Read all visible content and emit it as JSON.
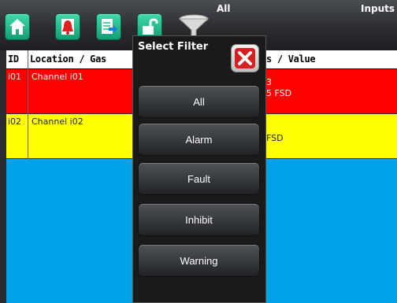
{
  "toolbar": {
    "filter_label": "All",
    "inputs_label": "Inputs",
    "icons": [
      "home-icon",
      "alarm-bell-icon",
      "export-document-icon",
      "unlock-icon",
      "filter-funnel-icon"
    ]
  },
  "table": {
    "headers": {
      "id": "ID",
      "location": "Location / Gas",
      "status": "s / Value"
    },
    "rows": [
      {
        "id": "i01",
        "location": "Channel i01",
        "value_line1": "3",
        "value_line2": "5 FSD",
        "color": "#ff0000"
      },
      {
        "id": "i02",
        "location": "Channel i02",
        "value_line1": "",
        "value_line2": "FSD",
        "color": "#ffff00"
      }
    ],
    "background": "#00a2e8"
  },
  "dialog": {
    "title": "Select Filter",
    "close_icon": "close-x-icon",
    "options": [
      {
        "label": "All"
      },
      {
        "label": "Alarm"
      },
      {
        "label": "Fault"
      },
      {
        "label": "Inhibit"
      },
      {
        "label": "Warning"
      }
    ]
  }
}
